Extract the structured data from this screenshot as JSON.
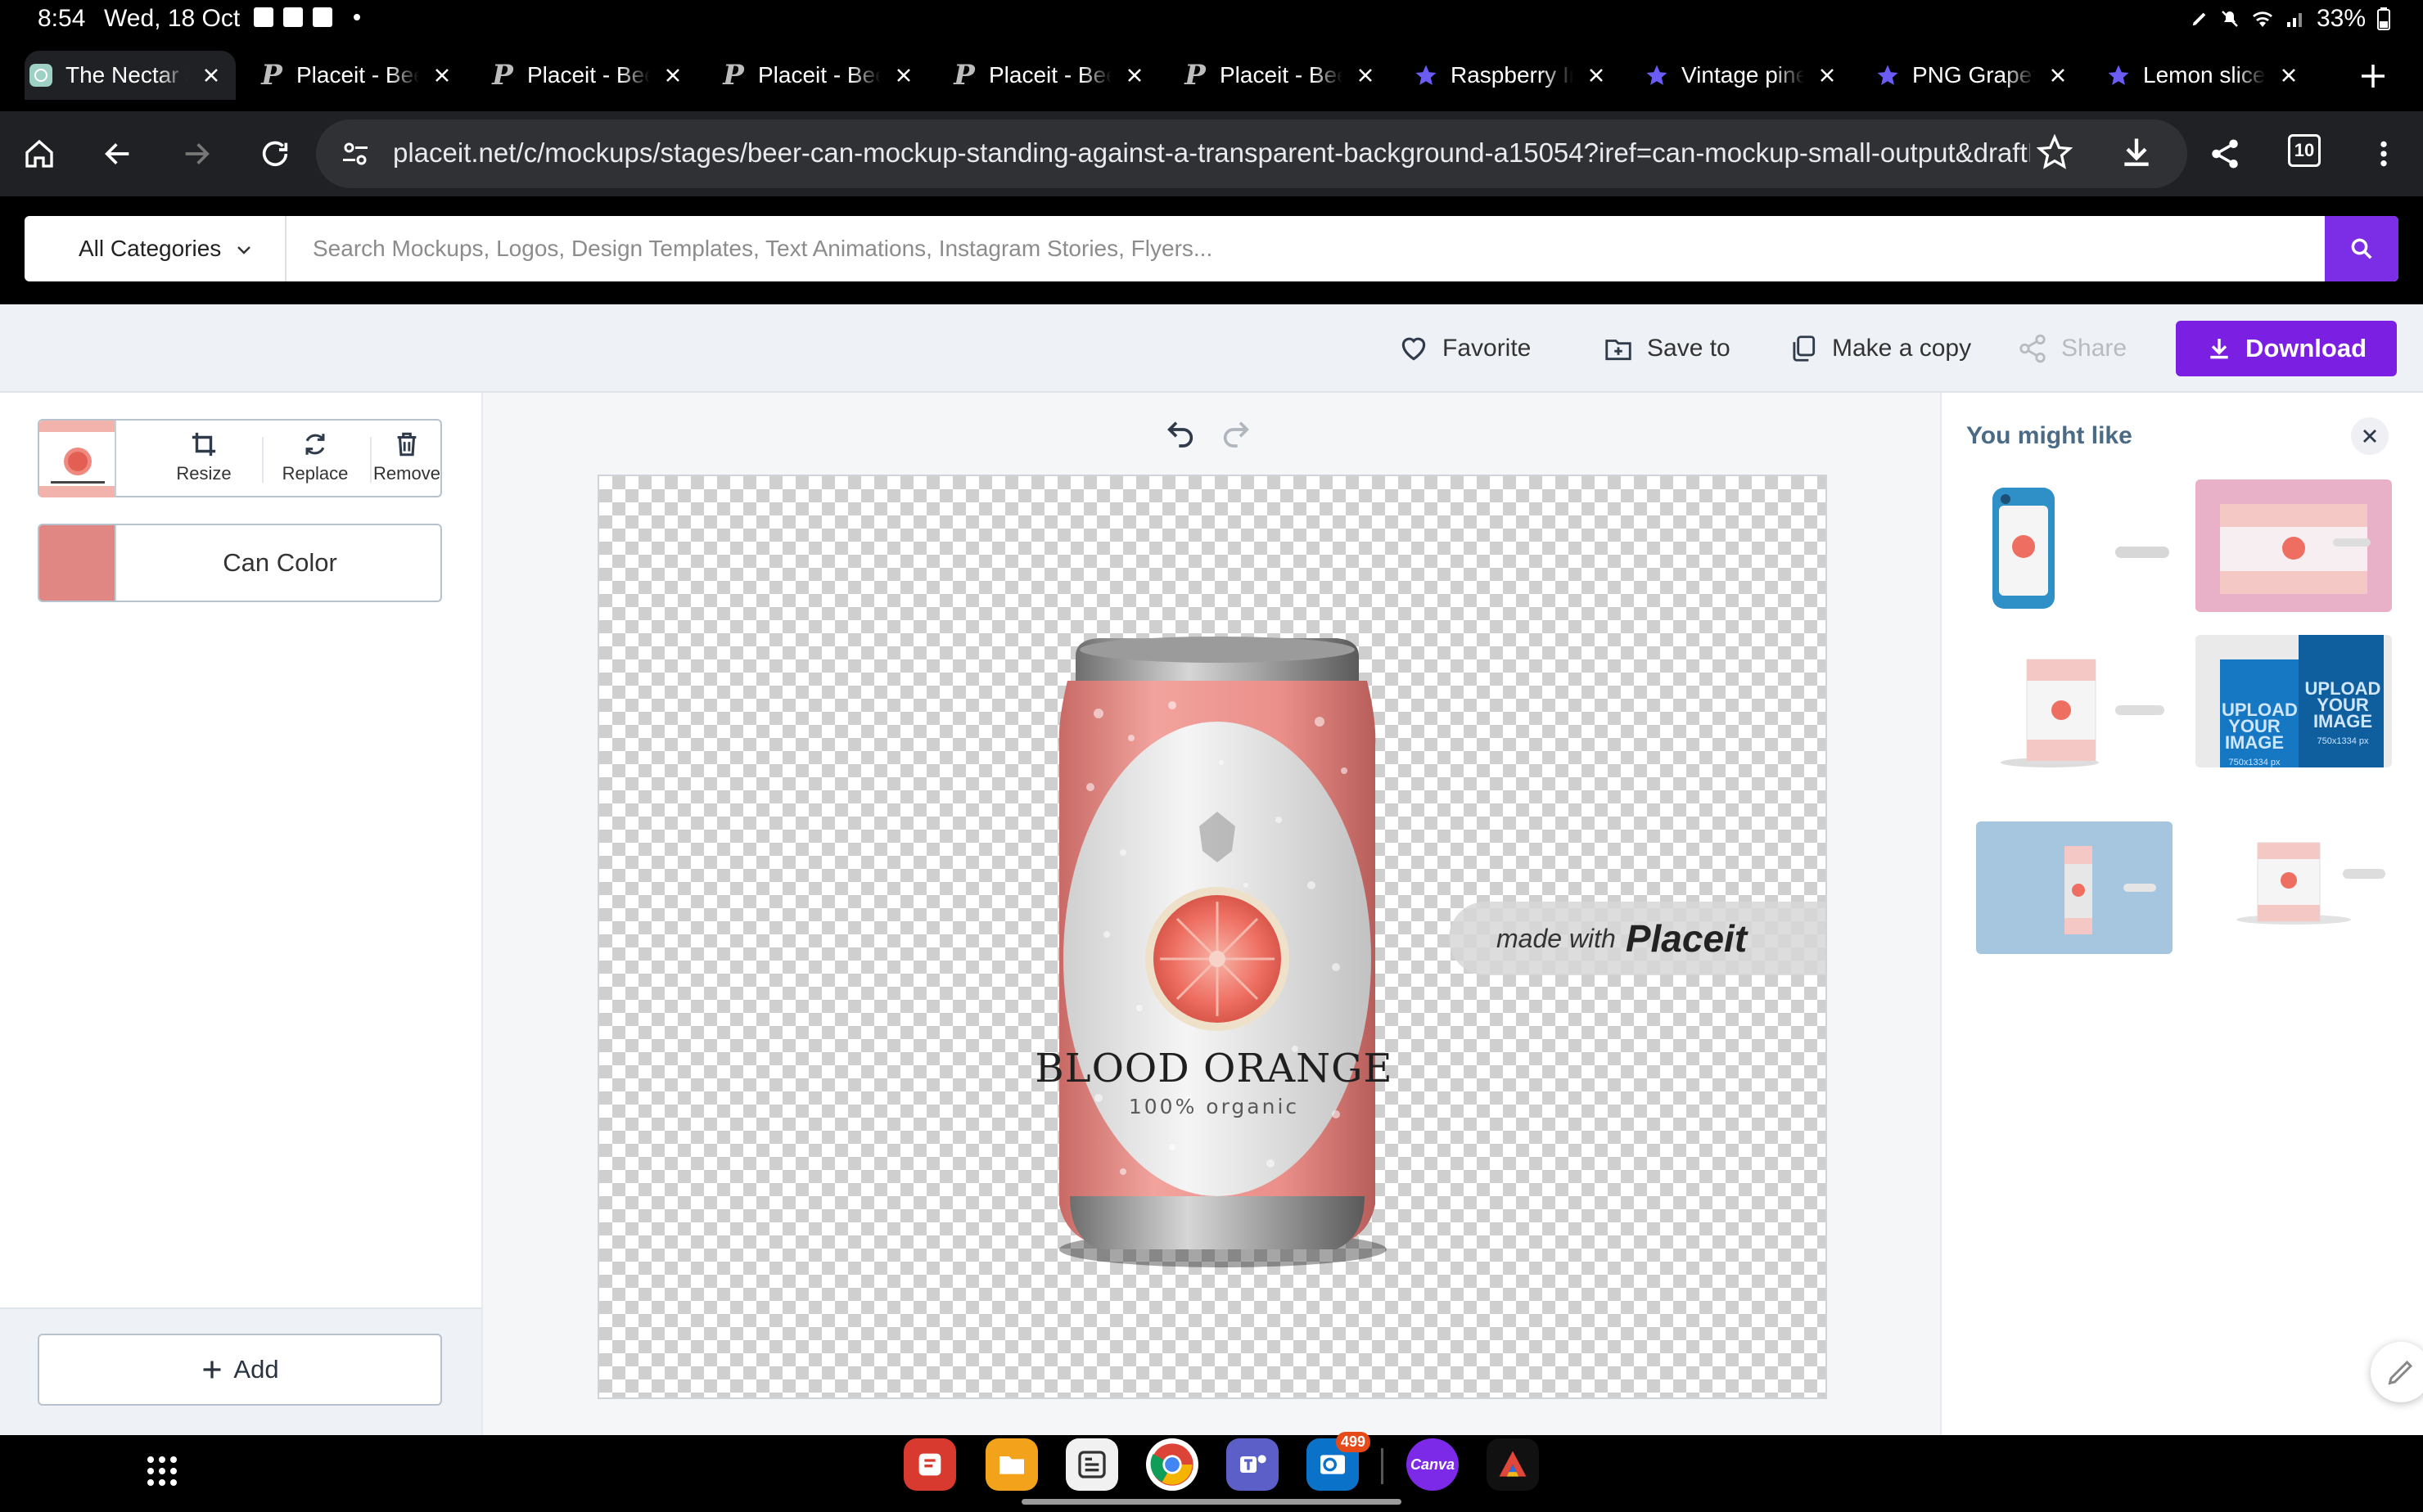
{
  "status_bar": {
    "time": "8:54",
    "date": "Wed, 18 Oct",
    "battery": "33%"
  },
  "tabs": [
    {
      "title": "The Nectar S",
      "favicon": "nectar-icon"
    },
    {
      "title": "Placeit - Bee",
      "favicon": "placeit-icon"
    },
    {
      "title": "Placeit - Bee",
      "favicon": "placeit-icon"
    },
    {
      "title": "Placeit - Bee",
      "favicon": "placeit-icon"
    },
    {
      "title": "Placeit - Bee",
      "favicon": "placeit-icon"
    },
    {
      "title": "Placeit - Bee",
      "favicon": "placeit-icon"
    },
    {
      "title": "Raspberry Im",
      "favicon": "star-icon"
    },
    {
      "title": "Vintage pine",
      "favicon": "star-icon"
    },
    {
      "title": "PNG Grapefr",
      "favicon": "star-icon"
    },
    {
      "title": "Lemon slice",
      "favicon": "star-icon"
    }
  ],
  "address_bar": {
    "url": "placeit.net/c/mockups/stages/beer-can-mockup-standing-against-a-transparent-background-a15054?iref=can-mockup-small-output&draftIc",
    "tab_count": "10"
  },
  "site_search": {
    "category": "All Categories",
    "placeholder": "Search Mockups, Logos, Design Templates, Text Animations, Instagram Stories, Flyers..."
  },
  "actions": {
    "favorite": "Favorite",
    "save_to": "Save to",
    "make_copy": "Make a copy",
    "share": "Share",
    "download": "Download"
  },
  "editor": {
    "layer_tools": {
      "resize": "Resize",
      "replace": "Replace",
      "remove": "Remove"
    },
    "can_color_label": "Can Color",
    "can_color": "#e08783",
    "add_label": "Add"
  },
  "canvas": {
    "product_title": "BLOOD ORANGE",
    "product_subtitle": "100% organic",
    "watermark_prefix": "made with",
    "watermark_brand": "Placeit"
  },
  "suggestions": {
    "title": "You might like",
    "upload_text": "UPLOAD YOUR IMAGE",
    "upload_size": "750x1334 px"
  },
  "dock": {
    "outlook_badge": "499",
    "canva_label": "Canva"
  },
  "colors": {
    "accent_purple": "#7b1fe3",
    "search_purple": "#7b2ee6",
    "browser_dark": "#202124"
  }
}
